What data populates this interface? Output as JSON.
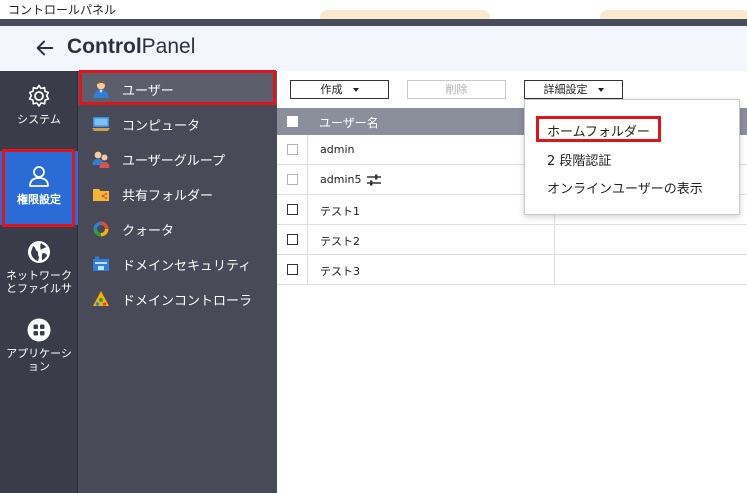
{
  "window": {
    "title": "コントロールパネル"
  },
  "header": {
    "title_bold": "Control",
    "title_light": "Panel"
  },
  "rail": [
    {
      "label_lines": [
        "システム"
      ],
      "icon": "gear-icon",
      "active": false
    },
    {
      "label_lines": [
        "権限設定"
      ],
      "icon": "user-icon",
      "active": true
    },
    {
      "label_lines": [
        "ネットワーク",
        "とファイルサ"
      ],
      "icon": "globe-icon",
      "active": false
    },
    {
      "label_lines": [
        "アプリケーシ",
        "ョン"
      ],
      "icon": "apps-grid-icon",
      "active": false
    }
  ],
  "submenu": [
    {
      "label": "ユーザー",
      "icon": "user-person-icon",
      "active": true
    },
    {
      "label": "コンピュータ",
      "icon": "computer-icon",
      "active": false
    },
    {
      "label": "ユーザーグループ",
      "icon": "user-group-icon",
      "active": false
    },
    {
      "label": "共有フォルダー",
      "icon": "shared-folder-icon",
      "active": false
    },
    {
      "label": "クォータ",
      "icon": "quota-icon",
      "active": false
    },
    {
      "label": "ドメインセキュリティ",
      "icon": "domain-security-icon",
      "active": false
    },
    {
      "label": "ドメインコントローラ",
      "icon": "domain-controller-icon",
      "active": false
    }
  ],
  "toolbar": {
    "create_label": "作成",
    "delete_label": "削除",
    "advanced_label": "詳細設定"
  },
  "table": {
    "header": "ユーザー名",
    "rows": [
      {
        "name": "admin",
        "dim_checkbox": true,
        "flag": false
      },
      {
        "name": "admin5",
        "dim_checkbox": true,
        "flag": true
      },
      {
        "name": "テスト1",
        "dim_checkbox": false,
        "flag": false
      },
      {
        "name": "テスト2",
        "dim_checkbox": false,
        "flag": false
      },
      {
        "name": "テスト3",
        "dim_checkbox": false,
        "flag": false
      }
    ]
  },
  "dropdown": {
    "items": [
      "ホームフォルダー",
      "2 段階認証",
      "オンラインユーザーの表示"
    ]
  },
  "colors": {
    "accent": "#2a6bd6",
    "highlight": "#e0151c",
    "rail_bg": "#3a3d49",
    "submenu_bg": "#484b57",
    "table_header": "#8b8f9c"
  }
}
